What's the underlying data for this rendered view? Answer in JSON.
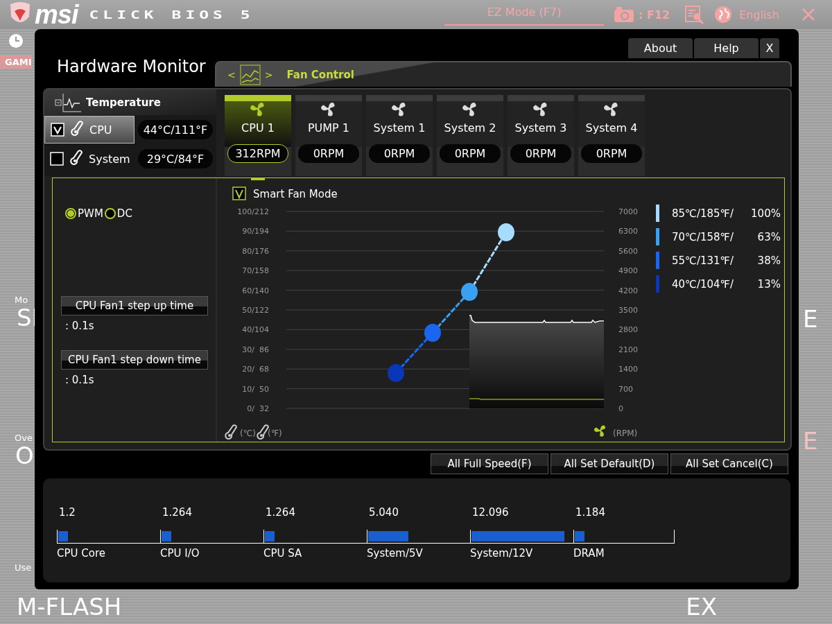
{
  "header": {
    "logo": "msi",
    "brand": "CLICK BIOS 5",
    "mode_tab": "EZ Mode (F7)",
    "screenshot_key": ": F12",
    "language": "English"
  },
  "background": {
    "tab": "GAMI",
    "left_items": [
      {
        "caption": "Mo",
        "title": "SI"
      },
      {
        "caption": "Ove",
        "title": "O"
      }
    ],
    "bottom_caption": "Use",
    "bottom_left": "M-FLASH",
    "right_items": [
      "E",
      "E"
    ],
    "bottom_right": "EX"
  },
  "window": {
    "title": "Hardware Monitor",
    "buttons": [
      "About",
      "Help",
      "X"
    ],
    "section": {
      "prev": "<",
      "label": "Fan Control",
      "next": ">"
    },
    "temperature": {
      "label": "Temperature",
      "sensors": [
        {
          "name": "CPU",
          "checked": true,
          "selected": true,
          "reading": "44°C/111°F"
        },
        {
          "name": "System",
          "checked": false,
          "selected": false,
          "reading": "29°C/84°F"
        }
      ]
    },
    "fans": [
      {
        "name": "CPU 1",
        "rpm": "312RPM",
        "selected": true
      },
      {
        "name": "PUMP 1",
        "rpm": "0RPM",
        "selected": false
      },
      {
        "name": "System 1",
        "rpm": "0RPM",
        "selected": false
      },
      {
        "name": "System 2",
        "rpm": "0RPM",
        "selected": false
      },
      {
        "name": "System 3",
        "rpm": "0RPM",
        "selected": false
      },
      {
        "name": "System 4",
        "rpm": "0RPM",
        "selected": false
      }
    ],
    "control_mode": [
      {
        "label": "PWM",
        "selected": true
      },
      {
        "label": "DC",
        "selected": false
      }
    ],
    "step_settings": [
      {
        "label": "CPU Fan1 step up time",
        "value": ": 0.1s"
      },
      {
        "label": "CPU Fan1 step down time",
        "value": ": 0.1s"
      }
    ],
    "smart_fan": {
      "label": "Smart Fan Mode",
      "checked": true
    },
    "chart": {
      "left_ticks": [
        "100/212",
        "90/194",
        "80/176",
        "70/158",
        "60/140",
        "50/122",
        "40/104",
        "30/  86",
        "20/  68",
        "10/  50",
        "0/  32"
      ],
      "right_ticks": [
        "7000",
        "6300",
        "5600",
        "4900",
        "4200",
        "3500",
        "2800",
        "2100",
        "1400",
        "700",
        "0"
      ],
      "celsius_unit": "(℃)",
      "fahrenheit_unit": "(℉)",
      "rpm_unit": "(RPM)"
    },
    "legend": [
      {
        "temp": "85℃/185℉/",
        "percent": "100%",
        "color": "#a8dcff"
      },
      {
        "temp": "70℃/158℉/",
        "percent": "63%",
        "color": "#3aa0f0"
      },
      {
        "temp": "55℃/131℉/",
        "percent": "38%",
        "color": "#1a66f0"
      },
      {
        "temp": "40℃/104℉/",
        "percent": "13%",
        "color": "#0a36b8"
      }
    ],
    "actions": [
      "All Full Speed(F)",
      "All Set Default(D)",
      "All Set Cancel(C)"
    ],
    "voltages": [
      {
        "value": "1.2",
        "name": "CPU Core",
        "level": 0.1
      },
      {
        "value": "1.264",
        "name": "CPU I/O",
        "level": 0.1
      },
      {
        "value": "1.264",
        "name": "CPU SA",
        "level": 0.1
      },
      {
        "value": "5.040",
        "name": "System/5V",
        "level": 0.4
      },
      {
        "value": "12.096",
        "name": "System/12V",
        "level": 0.93
      },
      {
        "value": "1.184",
        "name": "DRAM",
        "level": 0.1
      }
    ]
  }
}
